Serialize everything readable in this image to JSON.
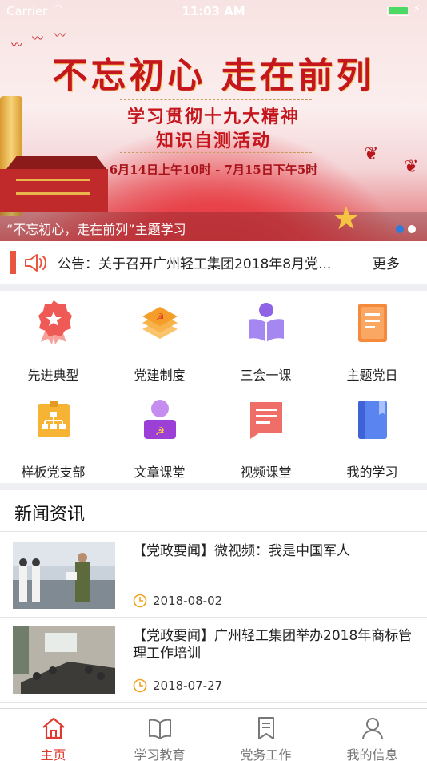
{
  "status_bar": {
    "carrier": "Carrier",
    "time": "11:03 AM"
  },
  "banner": {
    "headline": "不忘初心  走在前列",
    "subtitle_line1": "学习贯彻十九大精神",
    "subtitle_line2": "知识自测活动",
    "dates": "6月14日上午10时 - 7月15日下午5时",
    "caption": "“不忘初心，走在前列”主题学习",
    "page_count": 2,
    "active_page": 1,
    "dot_active_color": "#2f7bd9",
    "dot_inactive_color": "#ffffff"
  },
  "notice": {
    "text": "公告：关于召开广州轻工集团2018年8月党...",
    "more_label": "更多",
    "accent": "#e8563f"
  },
  "features": [
    {
      "label": "先进典型",
      "icon": "award-ribbon-icon"
    },
    {
      "label": "党建制度",
      "icon": "party-documents-icon"
    },
    {
      "label": "三会一课",
      "icon": "reader-book-icon"
    },
    {
      "label": "主题党日",
      "icon": "notebook-icon"
    },
    {
      "label": "样板党支部",
      "icon": "org-chart-icon"
    },
    {
      "label": "文章课堂",
      "icon": "party-member-icon"
    },
    {
      "label": "视频课堂",
      "icon": "article-card-icon"
    },
    {
      "label": "我的学习",
      "icon": "study-book-icon"
    }
  ],
  "news": {
    "section_title": "新闻资讯",
    "items": [
      {
        "title": "【党政要闻】微视频：我是中国军人",
        "date": "2018-08-02"
      },
      {
        "title": "【党政要闻】广州轻工集团举办2018年商标管理工作培训",
        "date": "2018-07-27"
      }
    ]
  },
  "tabs": [
    {
      "label": "主页",
      "icon": "home-icon",
      "active": true
    },
    {
      "label": "学习教育",
      "icon": "open-book-icon",
      "active": false
    },
    {
      "label": "党务工作",
      "icon": "bookmark-icon",
      "active": false
    },
    {
      "label": "我的信息",
      "icon": "user-icon",
      "active": false
    }
  ],
  "colors": {
    "brand_red": "#e03a2e",
    "tab_inactive": "#777777",
    "separator": "#eeeff3"
  }
}
